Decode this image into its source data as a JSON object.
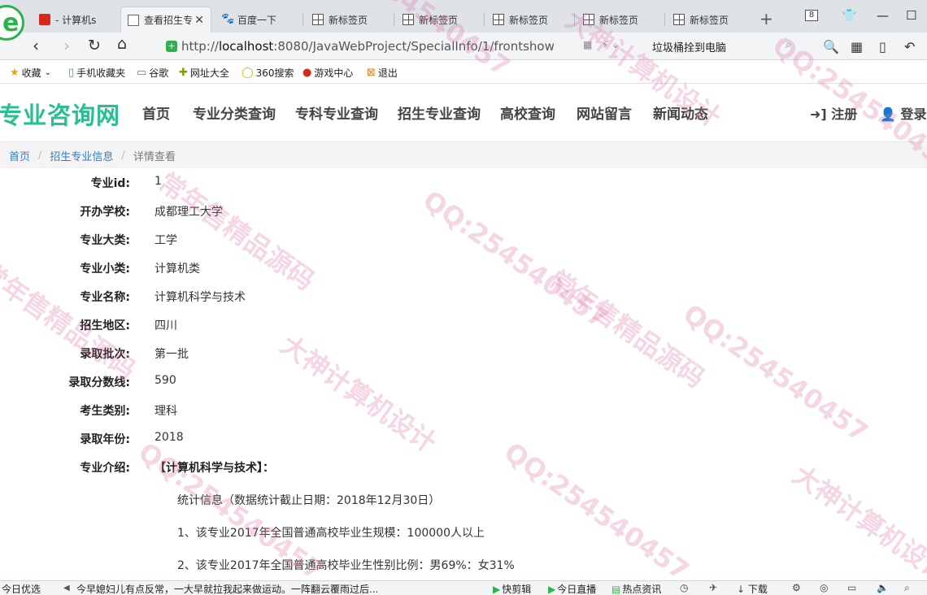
{
  "browser": {
    "logo_letter": "e",
    "tabs": [
      {
        "title": "- 计算机s",
        "icon": "red-square-icon"
      },
      {
        "title": "查看招生专",
        "icon": "document-icon",
        "active": true
      },
      {
        "title": "百度一下",
        "icon": "baidu-paw-icon"
      },
      {
        "title": "新标签页",
        "icon": "grid-icon"
      },
      {
        "title": "新标签页",
        "icon": "grid-icon"
      },
      {
        "title": "新标签页",
        "icon": "grid-icon"
      },
      {
        "title": "新标签页",
        "icon": "grid-icon"
      },
      {
        "title": "新标签页",
        "icon": "grid-icon"
      }
    ],
    "tab_count": "8",
    "url_prefix": "http://",
    "url_host": "localhost",
    "url_rest": ":8080/JavaWebProject/SpecialInfo/1/frontshow",
    "search_text": "垃圾桶拴到电脑",
    "bookmarks": [
      {
        "label": "收藏",
        "icon": "star-icon"
      },
      {
        "label": "手机收藏夹",
        "icon": "phone-icon"
      },
      {
        "label": "谷歌",
        "icon": "page-icon"
      },
      {
        "label": "网址大全",
        "icon": "compass-icon"
      },
      {
        "label": "360搜索",
        "icon": "search-ring-icon"
      },
      {
        "label": "游戏中心",
        "icon": "game-icon"
      },
      {
        "label": "退出",
        "icon": "exit-icon"
      }
    ]
  },
  "site": {
    "logo": "专业咨询网",
    "nav": [
      "首页",
      "专业分类查询",
      "专科专业查询",
      "招生专业查询",
      "高校查询",
      "网站留言",
      "新闻动态"
    ],
    "register": "注册",
    "login": "登录"
  },
  "breadcrumb": {
    "home": "首页",
    "section": "招生专业信息",
    "current": "详情查看"
  },
  "detail": {
    "fields": [
      {
        "label": "专业id:",
        "value": "1"
      },
      {
        "label": "开办学校:",
        "value": "成都理工大学"
      },
      {
        "label": "专业大类:",
        "value": "工学"
      },
      {
        "label": "专业小类:",
        "value": "计算机类"
      },
      {
        "label": "专业名称:",
        "value": "计算机科学与技术"
      },
      {
        "label": "招生地区:",
        "value": "四川"
      },
      {
        "label": "录取批次:",
        "value": "第一批"
      },
      {
        "label": "录取分数线:",
        "value": "590"
      },
      {
        "label": "考生类别:",
        "value": "理科"
      },
      {
        "label": "录取年份:",
        "value": "2018"
      }
    ],
    "intro_label": "专业介绍:",
    "intro_title": "【计算机科学与技术】：",
    "intro_lines": [
      "统计信息（数据统计截止日期：2018年12月30日）",
      "1、该专业2017年全国普通高校毕业生规模：100000人以上",
      "2、该专业2017年全国普通高校毕业生性别比例：男69%：女31%"
    ]
  },
  "watermarks": [
    "QQ:254540457",
    "大神计算机设计",
    "常年售精品源码"
  ],
  "statusbar": {
    "today": "今日优选",
    "news": "今早媳妇儿有点反常，一大早就拉我起来做运动。一阵翻云覆雨过后...",
    "items": [
      "快剪辑",
      "今日直播",
      "热点资讯",
      "下载"
    ]
  },
  "colors": {
    "logo": "#2abf91",
    "breadcrumb_link": "#3a7ac0",
    "watermark": "#dc78aa"
  }
}
